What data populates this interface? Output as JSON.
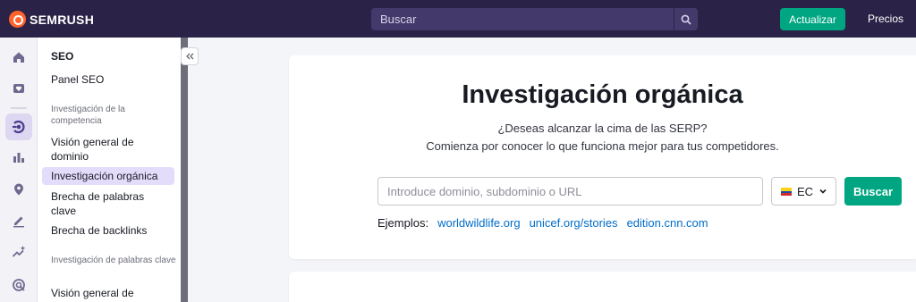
{
  "header": {
    "brand": "SEMRUSH",
    "search_placeholder": "Buscar",
    "update_label": "Actualizar",
    "prices_label": "Precios"
  },
  "rail": {
    "icons": [
      "home-icon",
      "heart-icon",
      "seo-icon",
      "bar-chart-icon",
      "location-pin-icon",
      "pencil-icon",
      "sparkle-chart-icon",
      "target-icon"
    ]
  },
  "sidebar": {
    "section": "SEO",
    "dashboard": "Panel SEO",
    "group_competition": "Investigación de la competencia",
    "domain_overview": "Visión general de dominio",
    "organic_research": "Investigación orgánica",
    "keyword_gap": "Brecha de palabras clave",
    "backlink_gap": "Brecha de backlinks",
    "group_keywords": "Investigación de palabras clave",
    "keyword_overview": "Visión general de"
  },
  "main": {
    "title": "Investigación orgánica",
    "subtitle_1": "¿Deseas alcanzar la cima de las SERP?",
    "subtitle_2": "Comienza por conocer lo que funciona mejor para tus competidores.",
    "input_placeholder": "Introduce dominio, subdominio o URL",
    "country": "EC",
    "search_button": "Buscar",
    "examples_label": "Ejemplos:",
    "examples": [
      "worldwildlife.org",
      "unicef.org/stories",
      "edition.cnn.com"
    ]
  },
  "colors": {
    "topbar": "#2b2347",
    "accent_green": "#00a682",
    "active_item": "#e4dcfb",
    "link": "#006dca",
    "brand_orange": "#ff642d"
  }
}
